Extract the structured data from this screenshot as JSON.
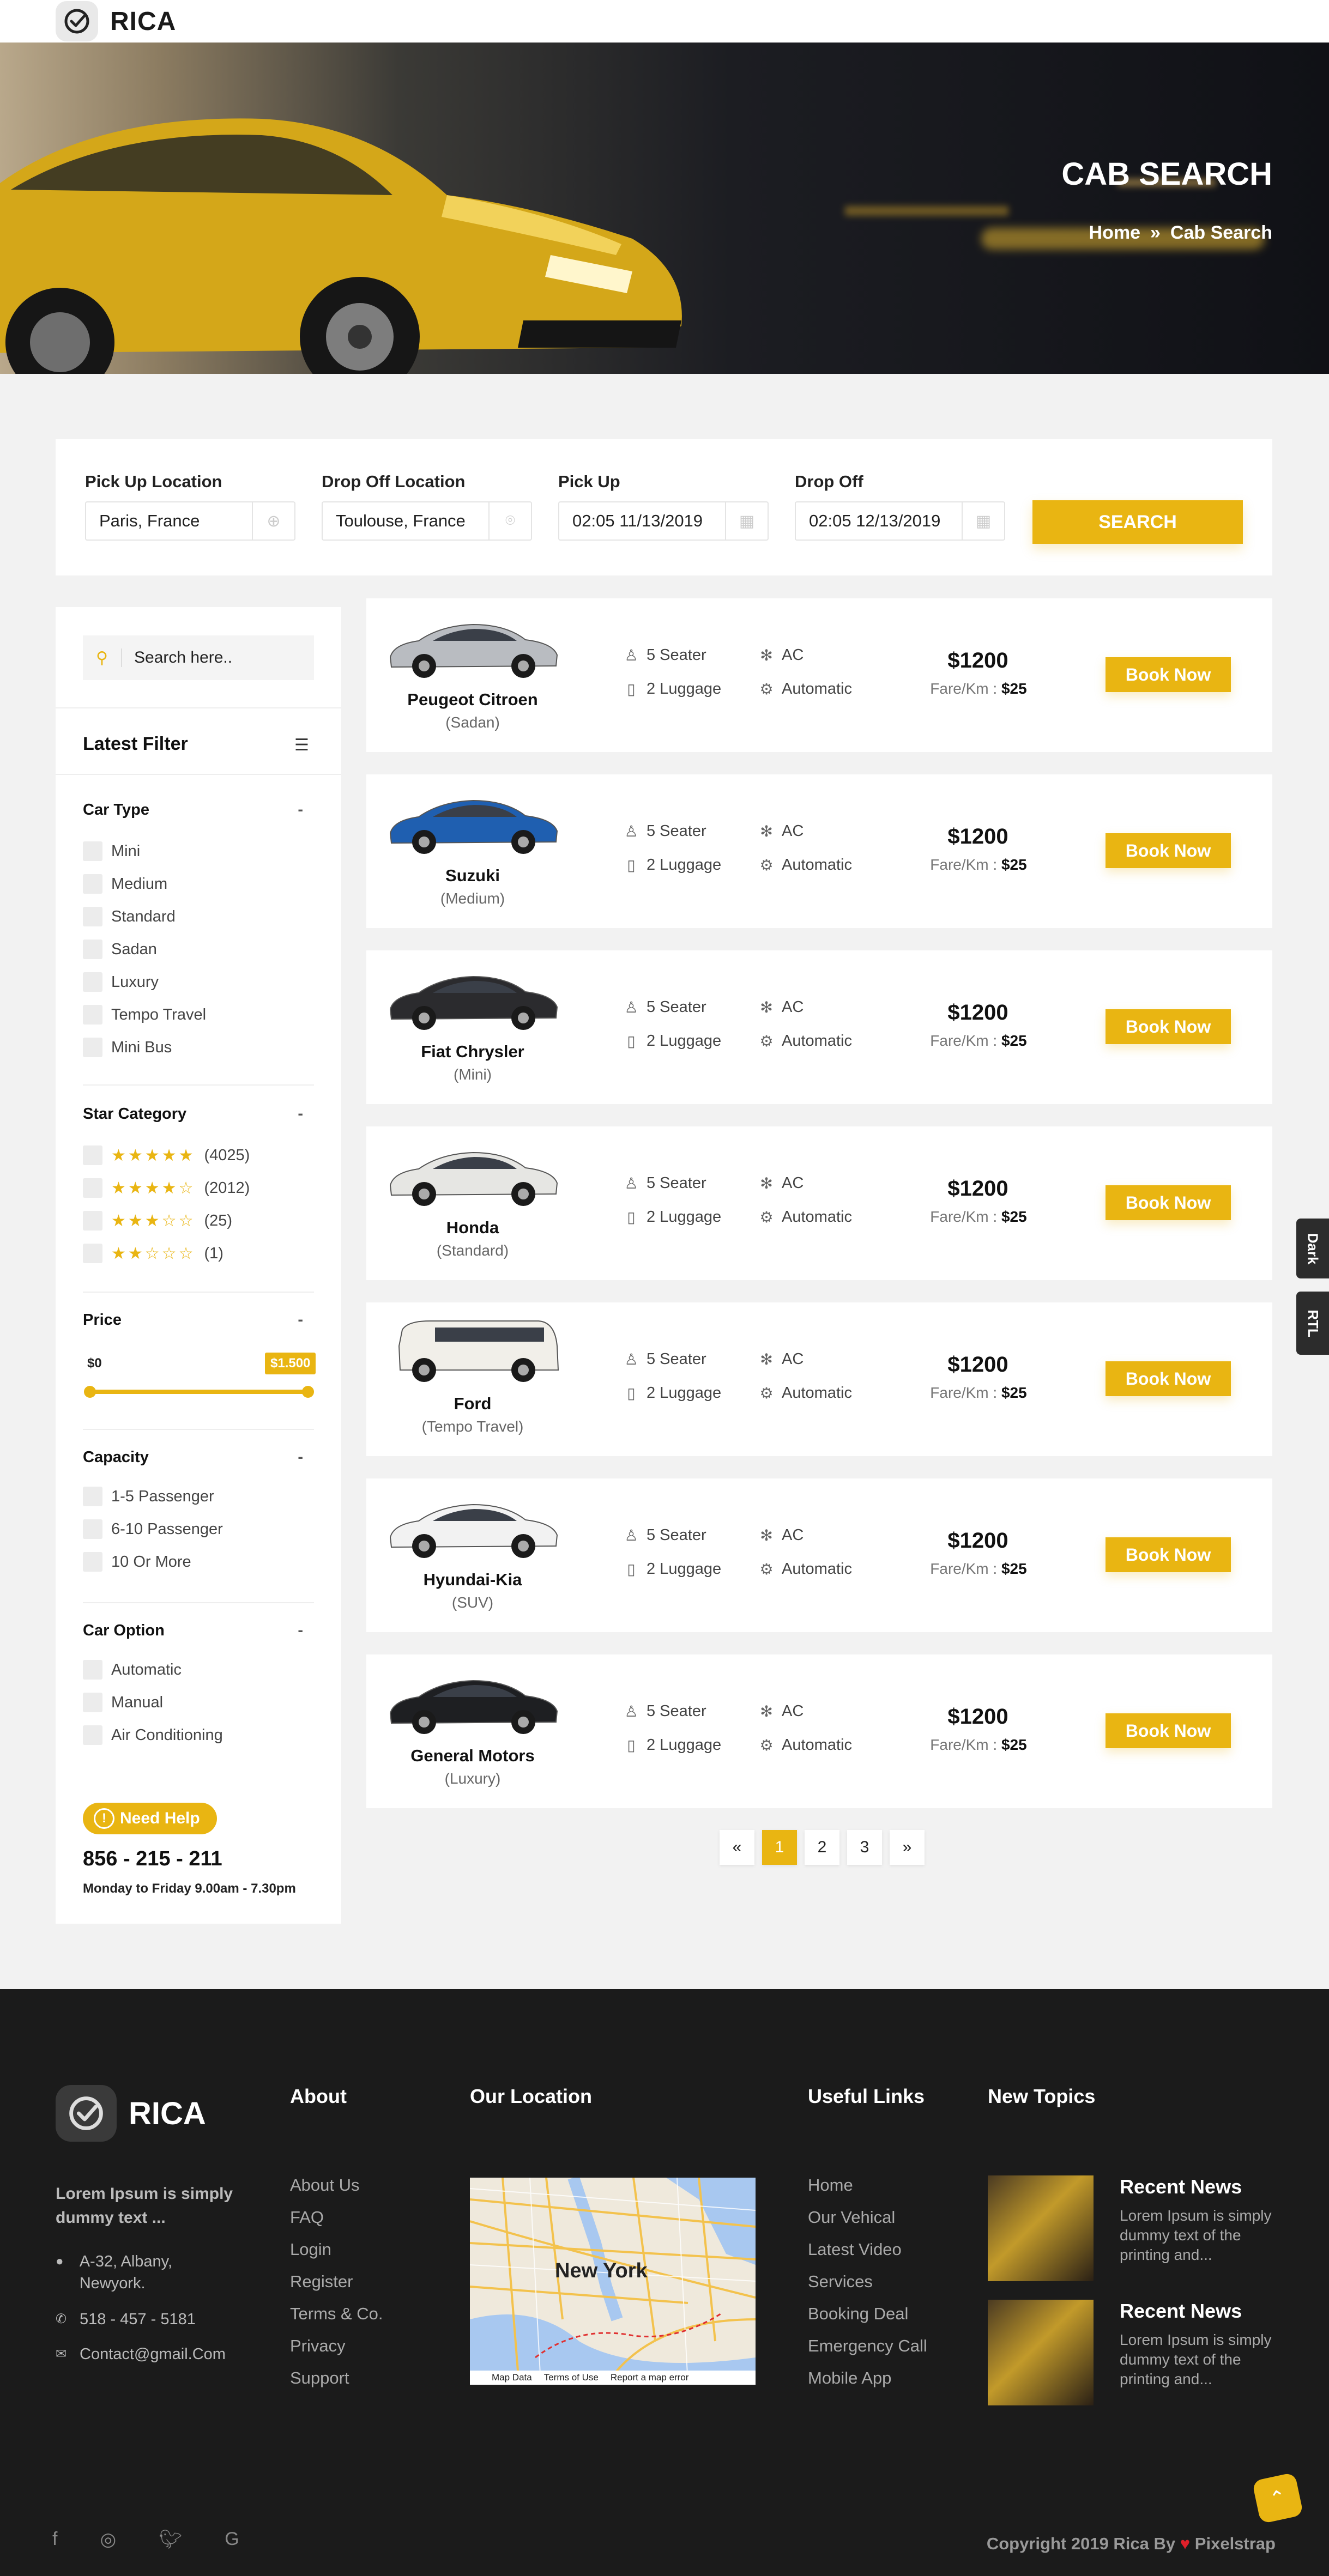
{
  "brand": {
    "name": "RICA"
  },
  "hero": {
    "title": "CAB SEARCH",
    "crumb_home": "Home",
    "crumb_sep": "»",
    "crumb_current": "Cab Search"
  },
  "search": {
    "pickup_location": {
      "label": "Pick Up Location",
      "value": "Paris, France"
    },
    "dropoff_location": {
      "label": "Drop Off Location",
      "value": "Toulouse, France"
    },
    "pickup": {
      "label": "Pick Up",
      "value": "02:05 11/13/2019"
    },
    "dropoff": {
      "label": "Drop Off",
      "value": "02:05 12/13/2019"
    },
    "button": "SEARCH"
  },
  "sidebar": {
    "search_placeholder": "Search here..",
    "latest_filter": "Latest Filter",
    "car_type": {
      "title": "Car Type",
      "toggle": "-",
      "options": [
        "Mini",
        "Medium",
        "Standard",
        "Sadan",
        "Luxury",
        "Tempo Travel",
        "Mini Bus"
      ]
    },
    "star_category": {
      "title": "Star Category",
      "toggle": "-",
      "options": [
        {
          "stars": 5,
          "count": "(4025)"
        },
        {
          "stars": 4,
          "count": "(2012)"
        },
        {
          "stars": 3,
          "count": "(25)"
        },
        {
          "stars": 2,
          "count": "(1)"
        }
      ]
    },
    "price": {
      "title": "Price",
      "toggle": "-",
      "min": "$0",
      "max": "$1.500"
    },
    "capacity": {
      "title": "Capacity",
      "toggle": "-",
      "options": [
        "1-5 Passenger",
        "6-10 Passenger",
        "10 Or More"
      ]
    },
    "car_option": {
      "title": "Car Option",
      "toggle": "-",
      "options": [
        "Automatic",
        "Manual",
        "Air Conditioning"
      ]
    },
    "help": {
      "label": "Need Help",
      "phone": "856 - 215 - 211",
      "hours": "Monday to Friday 9.00am - 7.30pm"
    }
  },
  "cars": [
    {
      "name": "Peugeot Citroen",
      "type": "(Sadan)",
      "seater": "5 Seater",
      "luggage": "2 Luggage",
      "ac": "AC",
      "trans": "Automatic",
      "price": "$1200",
      "fare_label": "Fare/Km : ",
      "fare": "$25",
      "button": "Book Now",
      "color": "#b9bcc1"
    },
    {
      "name": "Suzuki",
      "type": "(Medium)",
      "seater": "5 Seater",
      "luggage": "2 Luggage",
      "ac": "AC",
      "trans": "Automatic",
      "price": "$1200",
      "fare_label": "Fare/Km : ",
      "fare": "$25",
      "button": "Book Now",
      "color": "#1f5fb0"
    },
    {
      "name": "Fiat Chrysler",
      "type": "(Mini)",
      "seater": "5 Seater",
      "luggage": "2 Luggage",
      "ac": "AC",
      "trans": "Automatic",
      "price": "$1200",
      "fare_label": "Fare/Km : ",
      "fare": "$25",
      "button": "Book Now",
      "color": "#2b2b2e"
    },
    {
      "name": "Honda",
      "type": "(Standard)",
      "seater": "5 Seater",
      "luggage": "2 Luggage",
      "ac": "AC",
      "trans": "Automatic",
      "price": "$1200",
      "fare_label": "Fare/Km : ",
      "fare": "$25",
      "button": "Book Now",
      "color": "#e6e6e3"
    },
    {
      "name": "Ford",
      "type": "(Tempo Travel)",
      "seater": "5 Seater",
      "luggage": "2 Luggage",
      "ac": "AC",
      "trans": "Automatic",
      "price": "$1200",
      "fare_label": "Fare/Km : ",
      "fare": "$25",
      "button": "Book Now",
      "color": "#f1efe9"
    },
    {
      "name": "Hyundai-Kia",
      "type": "(SUV)",
      "seater": "5 Seater",
      "luggage": "2 Luggage",
      "ac": "AC",
      "trans": "Automatic",
      "price": "$1200",
      "fare_label": "Fare/Km : ",
      "fare": "$25",
      "button": "Book Now",
      "color": "#f2f2f2"
    },
    {
      "name": "General Motors",
      "type": "(Luxury)",
      "seater": "5 Seater",
      "luggage": "2 Luggage",
      "ac": "AC",
      "trans": "Automatic",
      "price": "$1200",
      "fare_label": "Fare/Km : ",
      "fare": "$25",
      "button": "Book Now",
      "color": "#1e1f22"
    }
  ],
  "pagination": {
    "prev": "«",
    "pages": [
      "1",
      "2",
      "3"
    ],
    "active": "1",
    "next": "»"
  },
  "side_tabs": {
    "dark": "Dark",
    "rtl": "RTL"
  },
  "footer": {
    "brand": "RICA",
    "about_text": "Lorem Ipsum is simply dummy text ...",
    "address": "A-32, Albany, Newyork.",
    "phone": "518 - 457 - 5181",
    "email": "Contact@gmail.Com",
    "about": {
      "title": "About",
      "links": [
        "About Us",
        "FAQ",
        "Login",
        "Register",
        "Terms & Co.",
        "Privacy",
        "Support"
      ]
    },
    "location": {
      "title": "Our Location",
      "city": "New York",
      "map_bar": [
        "Map Data",
        "Terms of Use",
        "Report a map error"
      ]
    },
    "useful": {
      "title": "Useful Links",
      "links": [
        "Home",
        "Our Vehical",
        "Latest Video",
        "Services",
        "Booking Deal",
        "Emergency Call",
        "Mobile App"
      ]
    },
    "topics": {
      "title": "New Topics",
      "items": [
        {
          "title": "Recent News",
          "text": "Lorem Ipsum is simply dummy text of the printing and..."
        },
        {
          "title": "Recent News",
          "text": "Lorem Ipsum is simply dummy text of the printing and..."
        }
      ]
    },
    "copyright_prefix": "Copyright 2019 Rica By ",
    "copyright_author": "Pixelstrap",
    "socials": [
      "facebook-icon",
      "instagram-icon",
      "twitter-icon",
      "google-icon"
    ]
  },
  "colors": {
    "accent": "#e9b512",
    "footer_bg": "#1b1b1b",
    "page_bg": "#f2f2f2"
  }
}
